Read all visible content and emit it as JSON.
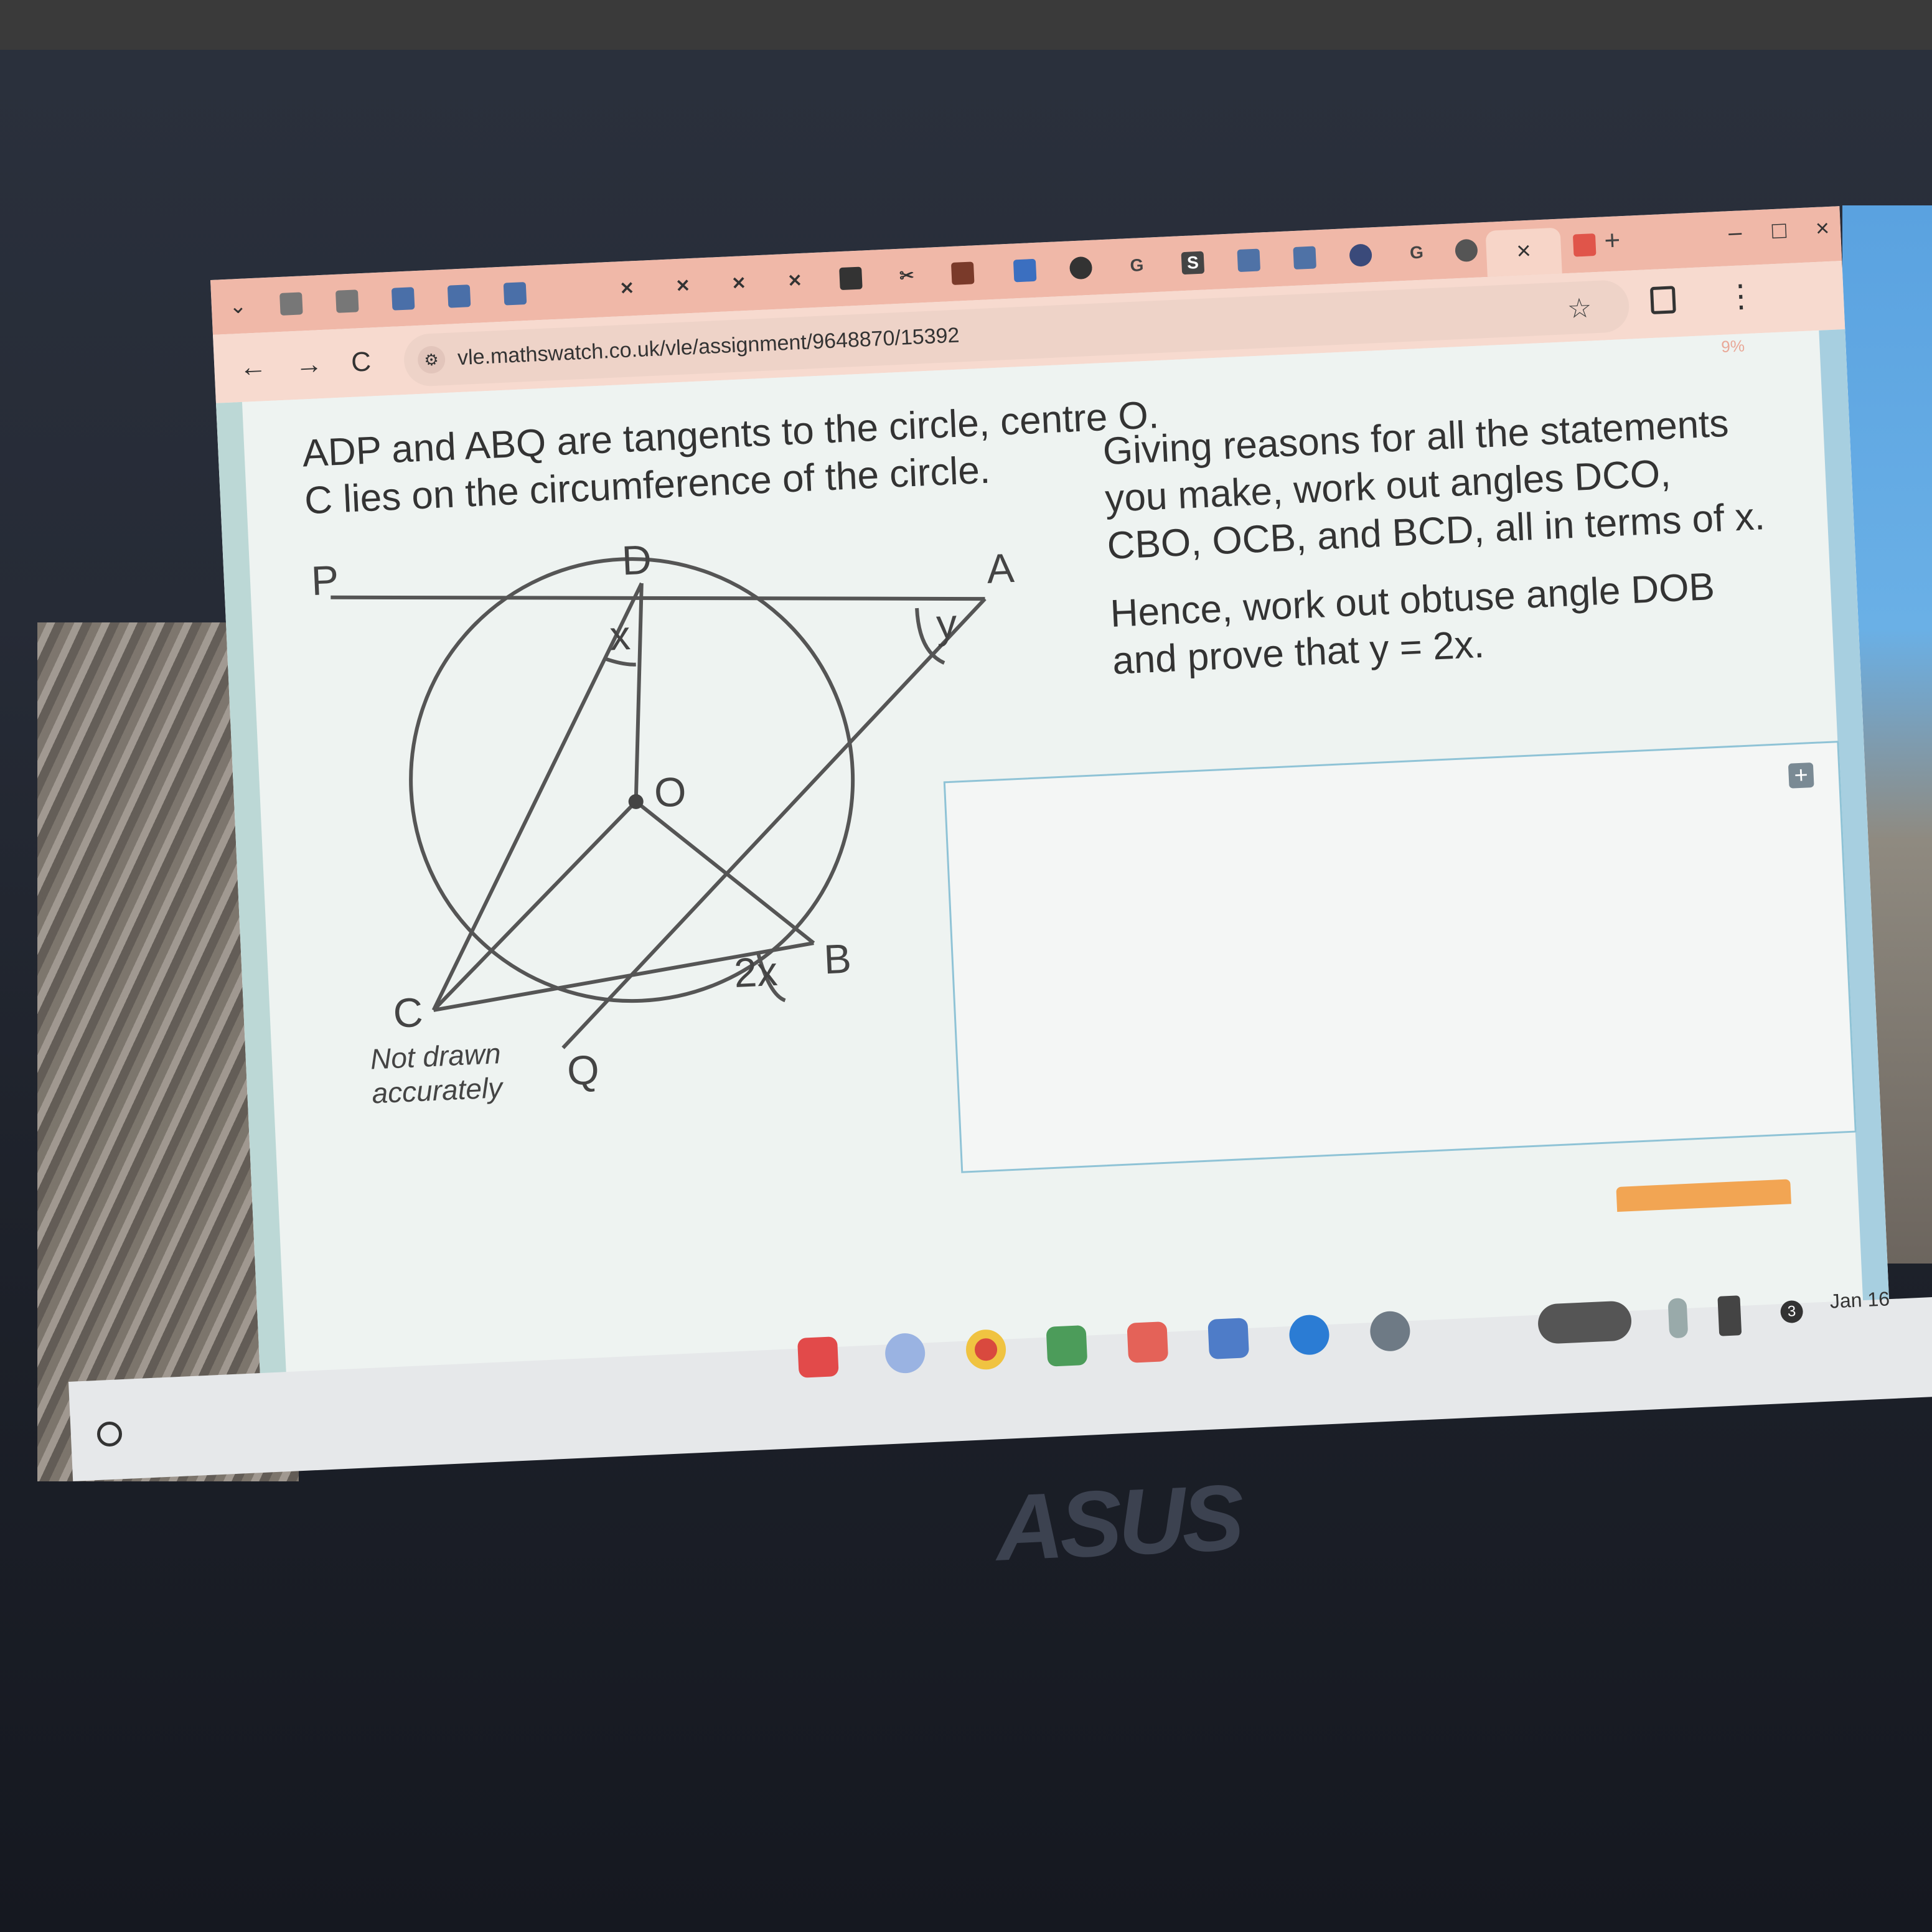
{
  "browser": {
    "url": "vle.mathswatch.co.uk/vle/assignment/9648870/15392",
    "progress_text": "9%",
    "close_tab_glyph": "×",
    "new_tab_glyph": "+",
    "window_controls": [
      "–",
      "□",
      "×"
    ],
    "nav_glyphs": {
      "back": "←",
      "forward": "→",
      "reload": "C"
    },
    "menu_glyph": "⋮",
    "star_glyph": "☆",
    "tab_icons": [
      "doc",
      "doc",
      "docs",
      "docs",
      "docs",
      "x",
      "x",
      "x",
      "x",
      "book",
      "tools",
      "flag",
      "plus",
      "globe",
      "G",
      "S",
      "slides",
      "slides",
      "globe",
      "G",
      "globe",
      "close"
    ],
    "accent": "#f0b8a8"
  },
  "question": {
    "intro_line1": "ADP and ABQ are tangents to the circle, centre O.",
    "intro_line2": "C lies on the circumference of the circle.",
    "instruction_line1": "Giving reasons for all the statements",
    "instruction_line2": "you make, work out angles DCO,",
    "instruction_line3": "CBO, OCB, and BCD, all in terms of x.",
    "hence_line1": "Hence, work out obtuse angle DOB",
    "hence_line2": "and prove that y = 2x."
  },
  "diagram": {
    "labels": {
      "P": "P",
      "D": "D",
      "A": "A",
      "O": "O",
      "C": "C",
      "B": "B",
      "Q": "Q"
    },
    "angle_x": "x",
    "angle_y": "y",
    "angle_2x": "2x",
    "note_line1": "Not drawn",
    "note_line2": "accurately"
  },
  "taskbar": {
    "date": "Jan 16",
    "notification_count": "3",
    "apps": [
      "youtube",
      "gemini",
      "chrome",
      "meet",
      "gmail",
      "calendar",
      "files",
      "settings"
    ]
  },
  "device": {
    "brand": "ASUS"
  }
}
